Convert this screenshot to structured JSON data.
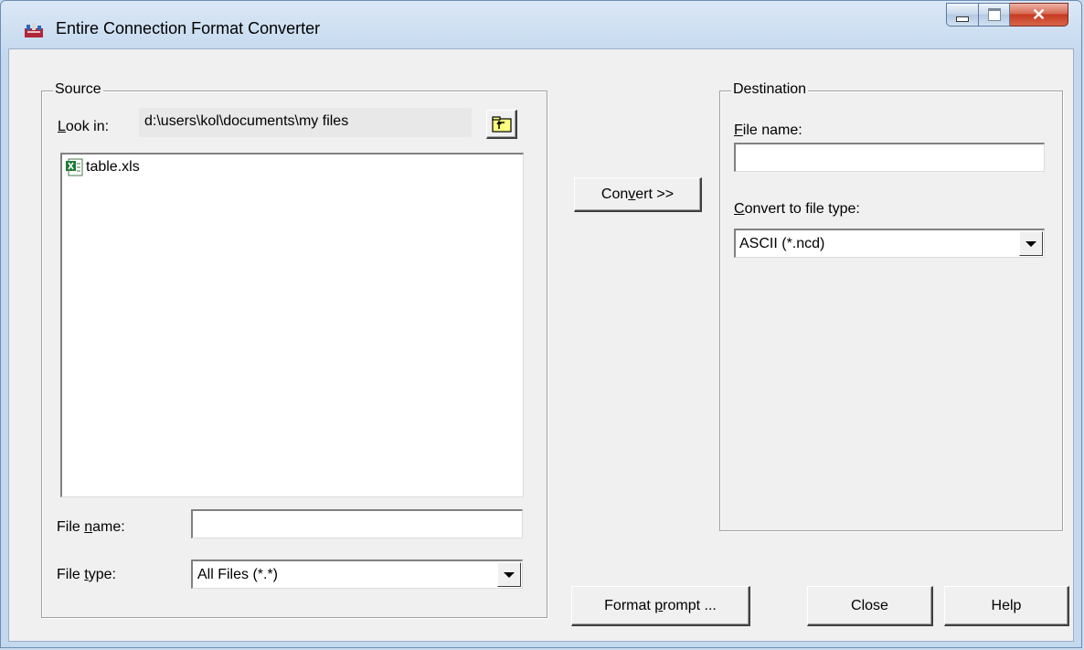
{
  "window": {
    "title": "Entire Connection Format Converter"
  },
  "source": {
    "group_title": "Source",
    "look_in_label_u": "L",
    "look_in_label_rest": "ook in:",
    "look_in_path": "d:\\users\\kol\\documents\\my files",
    "files": [
      {
        "name": "table.xls",
        "icon": "excel-file-icon"
      }
    ],
    "file_name_label_pre": "File ",
    "file_name_label_u": "n",
    "file_name_label_post": "ame:",
    "file_name_value": "",
    "file_type_label_pre": "File ",
    "file_type_label_u": "t",
    "file_type_label_post": "ype:",
    "file_type_value": "All Files (*.*)"
  },
  "convert_button": {
    "pre": "Con",
    "u": "v",
    "post": "ert >>"
  },
  "destination": {
    "group_title": "Destination",
    "file_name_label_u": "F",
    "file_name_label_rest": "ile name:",
    "file_name_value": "",
    "convert_type_label_u": "C",
    "convert_type_label_rest": "onvert to file type:",
    "convert_type_value": "ASCII (*.ncd)"
  },
  "buttons": {
    "format_prompt_pre": "Format ",
    "format_prompt_u": "p",
    "format_prompt_post": "rompt ...",
    "close": "Close",
    "help": "Help"
  }
}
